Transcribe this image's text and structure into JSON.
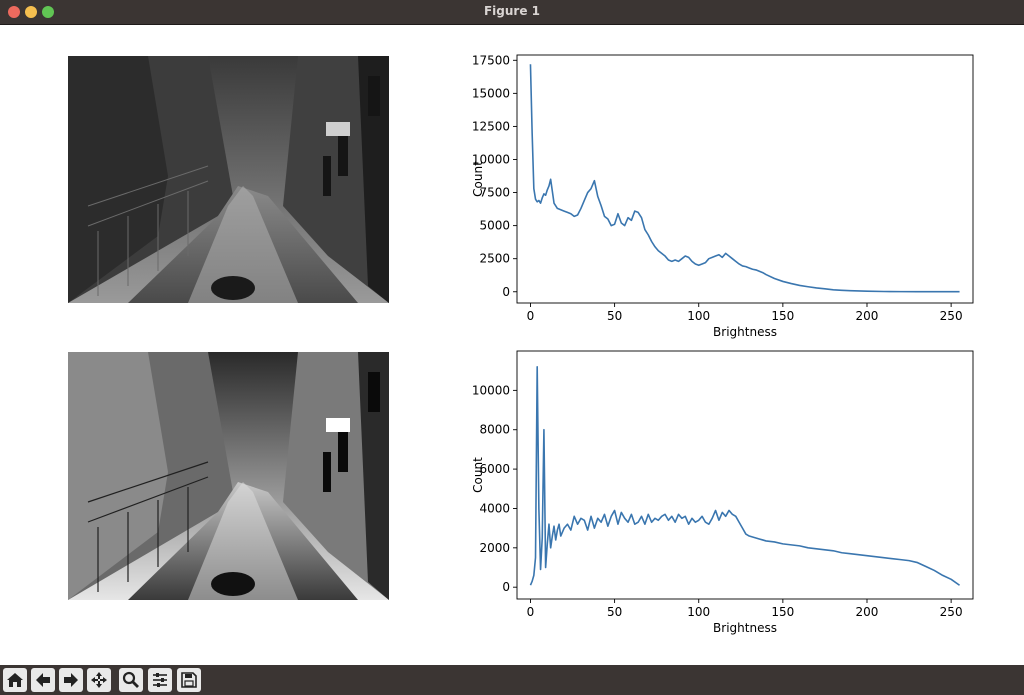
{
  "window": {
    "title": "Figure 1"
  },
  "toolbar": {
    "buttons": [
      {
        "name": "home-icon"
      },
      {
        "name": "back-arrow-icon"
      },
      {
        "name": "forward-arrow-icon"
      },
      {
        "name": "pan-move-icon"
      },
      {
        "name": "zoom-magnifier-icon"
      },
      {
        "name": "configure-subplots-icon"
      },
      {
        "name": "save-floppy-icon"
      }
    ]
  },
  "images": [
    {
      "description_name": "original-grayscale-street-photo"
    },
    {
      "description_name": "equalized-grayscale-street-photo"
    }
  ],
  "chart_data": [
    {
      "type": "line",
      "xlabel": "Brightness",
      "ylabel": "Count",
      "xlim": [
        -8,
        263
      ],
      "ylim": [
        -850,
        17900
      ],
      "xticks": [
        0,
        50,
        100,
        150,
        200,
        250
      ],
      "yticks": [
        0,
        2500,
        5000,
        7500,
        10000,
        12500,
        15000,
        17500
      ],
      "color": "#3a76af",
      "x": [
        0,
        1,
        2,
        3,
        4,
        5,
        6,
        7,
        8,
        9,
        10,
        11,
        12,
        13,
        14,
        15,
        16,
        18,
        20,
        22,
        24,
        26,
        28,
        30,
        32,
        34,
        36,
        38,
        40,
        42,
        44,
        46,
        48,
        50,
        52,
        54,
        56,
        58,
        60,
        62,
        64,
        66,
        68,
        70,
        72,
        74,
        76,
        78,
        80,
        82,
        84,
        86,
        88,
        90,
        92,
        94,
        96,
        98,
        100,
        102,
        104,
        106,
        108,
        110,
        112,
        114,
        116,
        118,
        120,
        122,
        124,
        126,
        128,
        130,
        132,
        134,
        136,
        138,
        140,
        145,
        150,
        155,
        160,
        165,
        170,
        175,
        180,
        185,
        190,
        200,
        210,
        220,
        230,
        240,
        250,
        255
      ],
      "y": [
        17200,
        12000,
        7800,
        7000,
        6800,
        6900,
        6700,
        7100,
        7400,
        7300,
        7700,
        8000,
        8500,
        7600,
        6700,
        6500,
        6300,
        6200,
        6100,
        6000,
        5900,
        5700,
        5800,
        6300,
        6900,
        7500,
        7800,
        8400,
        7200,
        6500,
        5700,
        5500,
        5000,
        5100,
        5900,
        5200,
        5000,
        5600,
        5400,
        6100,
        6000,
        5600,
        4700,
        4300,
        3800,
        3400,
        3100,
        2900,
        2700,
        2400,
        2300,
        2400,
        2300,
        2500,
        2700,
        2600,
        2300,
        2100,
        2000,
        2100,
        2200,
        2500,
        2600,
        2700,
        2800,
        2600,
        2900,
        2700,
        2500,
        2300,
        2100,
        1950,
        1900,
        1800,
        1700,
        1650,
        1550,
        1450,
        1300,
        1000,
        780,
        620,
        480,
        380,
        290,
        220,
        150,
        110,
        80,
        40,
        20,
        10,
        5,
        3,
        2,
        2
      ]
    },
    {
      "type": "line",
      "xlabel": "Brightness",
      "ylabel": "Count",
      "xlim": [
        -8,
        263
      ],
      "ylim": [
        -600,
        12000
      ],
      "xticks": [
        0,
        50,
        100,
        150,
        200,
        250
      ],
      "yticks": [
        0,
        2000,
        4000,
        6000,
        8000,
        10000
      ],
      "color": "#3a76af",
      "x": [
        0,
        1,
        2,
        3,
        4,
        5,
        6,
        7,
        8,
        9,
        10,
        11,
        12,
        13,
        14,
        15,
        16,
        17,
        18,
        20,
        22,
        24,
        26,
        28,
        30,
        32,
        34,
        36,
        38,
        40,
        42,
        44,
        46,
        48,
        50,
        52,
        54,
        56,
        58,
        60,
        62,
        64,
        66,
        68,
        70,
        72,
        74,
        76,
        78,
        80,
        82,
        84,
        86,
        88,
        90,
        92,
        94,
        96,
        98,
        100,
        102,
        104,
        106,
        108,
        110,
        112,
        114,
        116,
        118,
        120,
        122,
        124,
        126,
        128,
        130,
        132,
        134,
        136,
        138,
        140,
        145,
        150,
        155,
        160,
        165,
        170,
        175,
        180,
        185,
        190,
        195,
        200,
        205,
        210,
        215,
        220,
        225,
        230,
        235,
        240,
        245,
        250,
        255
      ],
      "y": [
        100,
        300,
        600,
        1500,
        11200,
        4000,
        900,
        2500,
        8000,
        1000,
        2200,
        3200,
        2000,
        2600,
        3100,
        2400,
        2900,
        3200,
        2600,
        3000,
        3200,
        2900,
        3600,
        3200,
        3500,
        3400,
        2900,
        3600,
        3000,
        3500,
        3300,
        3700,
        3100,
        3600,
        3900,
        3200,
        3800,
        3500,
        3300,
        3700,
        3200,
        3300,
        3600,
        3200,
        3700,
        3300,
        3500,
        3400,
        3600,
        3700,
        3400,
        3600,
        3300,
        3700,
        3500,
        3600,
        3200,
        3500,
        3300,
        3400,
        3600,
        3300,
        3200,
        3500,
        3900,
        3400,
        3800,
        3600,
        3900,
        3700,
        3600,
        3300,
        3000,
        2700,
        2600,
        2550,
        2500,
        2450,
        2400,
        2350,
        2300,
        2200,
        2150,
        2100,
        2000,
        1950,
        1900,
        1850,
        1750,
        1700,
        1650,
        1600,
        1550,
        1500,
        1450,
        1400,
        1350,
        1250,
        1050,
        850,
        600,
        400,
        100
      ]
    }
  ]
}
